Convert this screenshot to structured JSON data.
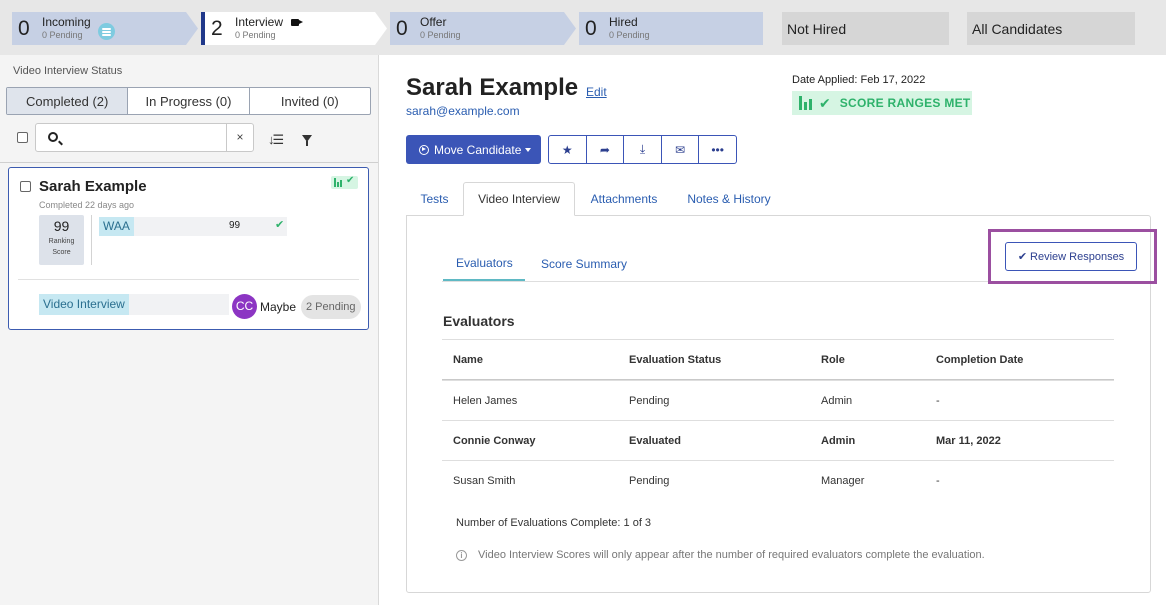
{
  "pipeline": {
    "stages": [
      {
        "count": "0",
        "label": "Incoming",
        "pending": "0 Pending"
      },
      {
        "count": "2",
        "label": "Interview",
        "pending": "0 Pending"
      },
      {
        "count": "0",
        "label": "Offer",
        "pending": "0 Pending"
      },
      {
        "count": "0",
        "label": "Hired",
        "pending": "0 Pending"
      }
    ],
    "not_hired": "Not Hired",
    "all_candidates": "All Candidates"
  },
  "left": {
    "title": "Video Interview Status",
    "segments": [
      "Completed (2)",
      "In Progress (0)",
      "Invited (0)"
    ],
    "clear_symbol": "×",
    "card": {
      "name": "Sarah Example",
      "completed": "Completed 22 days ago",
      "ranking_score": "99",
      "ranking_label_1": "Ranking",
      "ranking_label_2": "Score",
      "test_tag": "WAA",
      "test_score": "99",
      "video_tag": "Video Interview",
      "avatar_initials": "CC",
      "evaluation": "Maybe",
      "pending": "2 Pending"
    }
  },
  "candidate": {
    "name": "Sarah Example",
    "edit": "Edit",
    "email": "sarah@example.com",
    "date_applied": "Date Applied: Feb 17, 2022",
    "score_ranges": "SCORE RANGES MET",
    "move_button": "Move Candidate"
  },
  "tabs": [
    "Tests",
    "Video Interview",
    "Attachments",
    "Notes & History"
  ],
  "subtabs": [
    "Evaluators",
    "Score Summary"
  ],
  "review_button": "Review Responses",
  "evaluators": {
    "title": "Evaluators",
    "headers": [
      "Name",
      "Evaluation Status",
      "Role",
      "Completion Date"
    ],
    "rows": [
      [
        "Helen James",
        "Pending",
        "Admin",
        "-"
      ],
      [
        "Connie Conway",
        "Evaluated",
        "Admin",
        "Mar 11, 2022"
      ],
      [
        "Susan Smith",
        "Pending",
        "Manager",
        "-"
      ]
    ],
    "count": "Number of Evaluations Complete: 1 of 3",
    "note": "Video Interview Scores will only appear after the number of required evaluators complete the evaluation."
  },
  "colors": {
    "accent": "#3b55b7",
    "success": "#2eb26b",
    "highlight": "#9b4fa0",
    "avatar": "#8c35c3"
  },
  "icons": [
    "menu-circle-icon",
    "video-camera-icon",
    "search-icon",
    "sort-icon",
    "filter-icon",
    "bar-chart-icon",
    "check-icon",
    "star-icon",
    "share-icon",
    "download-icon",
    "envelope-icon",
    "more-icon",
    "info-icon"
  ]
}
